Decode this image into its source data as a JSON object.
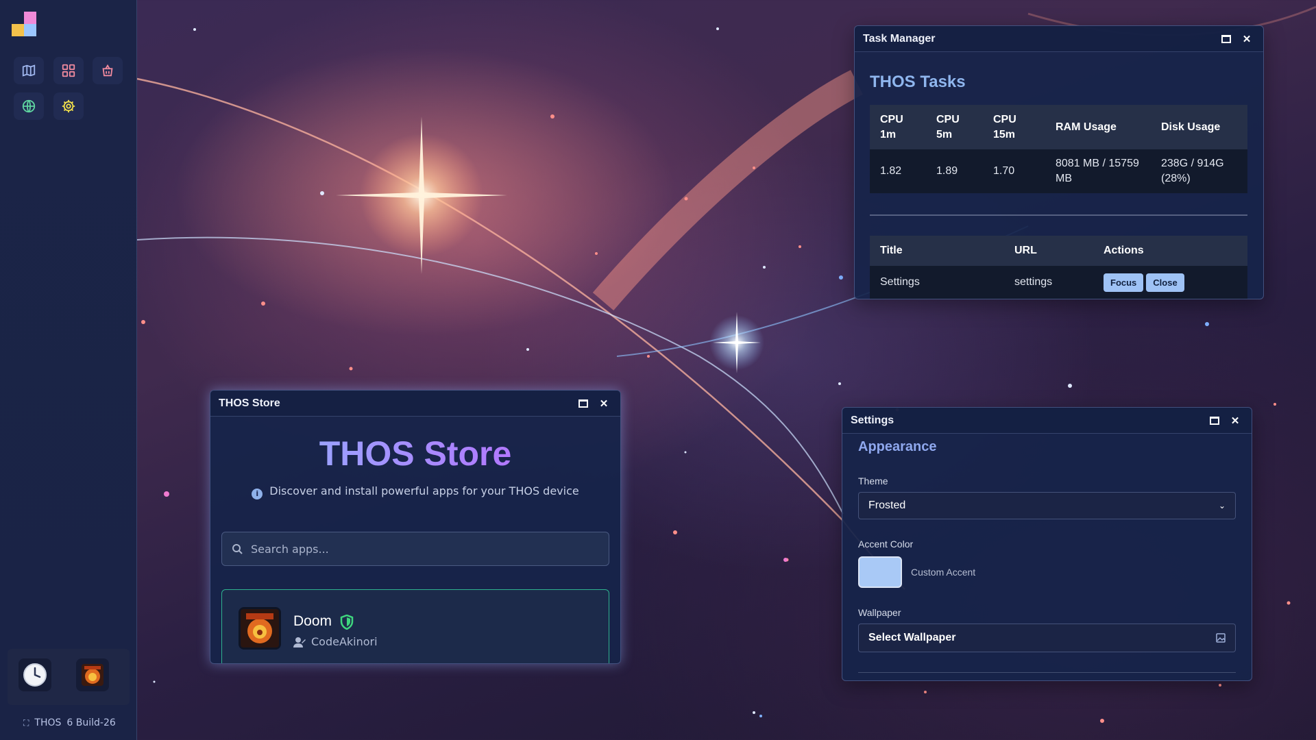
{
  "sidebar": {
    "apps": [
      {
        "name": "map-icon",
        "color": "#9fb6ee"
      },
      {
        "name": "grid-icon",
        "color": "#f08a9e"
      },
      {
        "name": "shopping-bag-icon",
        "color": "#f08a9e"
      },
      {
        "name": "globe-icon",
        "color": "#5fd4a0"
      },
      {
        "name": "gear-icon",
        "color": "#f3e14b"
      }
    ],
    "dock": [
      {
        "name": "clock-icon"
      },
      {
        "name": "doom-icon"
      }
    ],
    "version": {
      "os": "THOS",
      "build": "6 Build-26"
    }
  },
  "task_manager": {
    "window_title": "Task Manager",
    "heading": "THOS Tasks",
    "stats_headers": [
      "CPU 1m",
      "CPU 5m",
      "CPU 15m",
      "RAM Usage",
      "Disk Usage"
    ],
    "stats_values": [
      "1.82",
      "1.89",
      "1.70",
      "8081 MB / 15759 MB",
      "238G / 914G (28%)"
    ],
    "task_headers": [
      "Title",
      "URL",
      "Actions"
    ],
    "tasks": [
      {
        "title": "Settings",
        "url": "settings",
        "focus_label": "Focus",
        "close_label": "Close"
      }
    ]
  },
  "store": {
    "window_title": "THOS Store",
    "heading": "THOS Store",
    "subtitle": "Discover and install powerful apps for your THOS device",
    "search_placeholder": "Search apps...",
    "apps": [
      {
        "name": "Doom",
        "author": "CodeAkinori",
        "verified": true
      }
    ]
  },
  "settings": {
    "window_title": "Settings",
    "section": "Appearance",
    "theme_label": "Theme",
    "theme_value": "Frosted",
    "accent_label": "Accent Color",
    "accent_color": "#a9c9f6",
    "accent_caption": "Custom Accent",
    "wallpaper_label": "Wallpaper",
    "wallpaper_button": "Select Wallpaper"
  },
  "colors": {
    "accent": "#9ec2f5",
    "heading_blue": "#8fb6ee",
    "store_gradient_start": "#8fb9ff",
    "store_gradient_end": "#c06af2",
    "card_border": "#2fb38f"
  }
}
